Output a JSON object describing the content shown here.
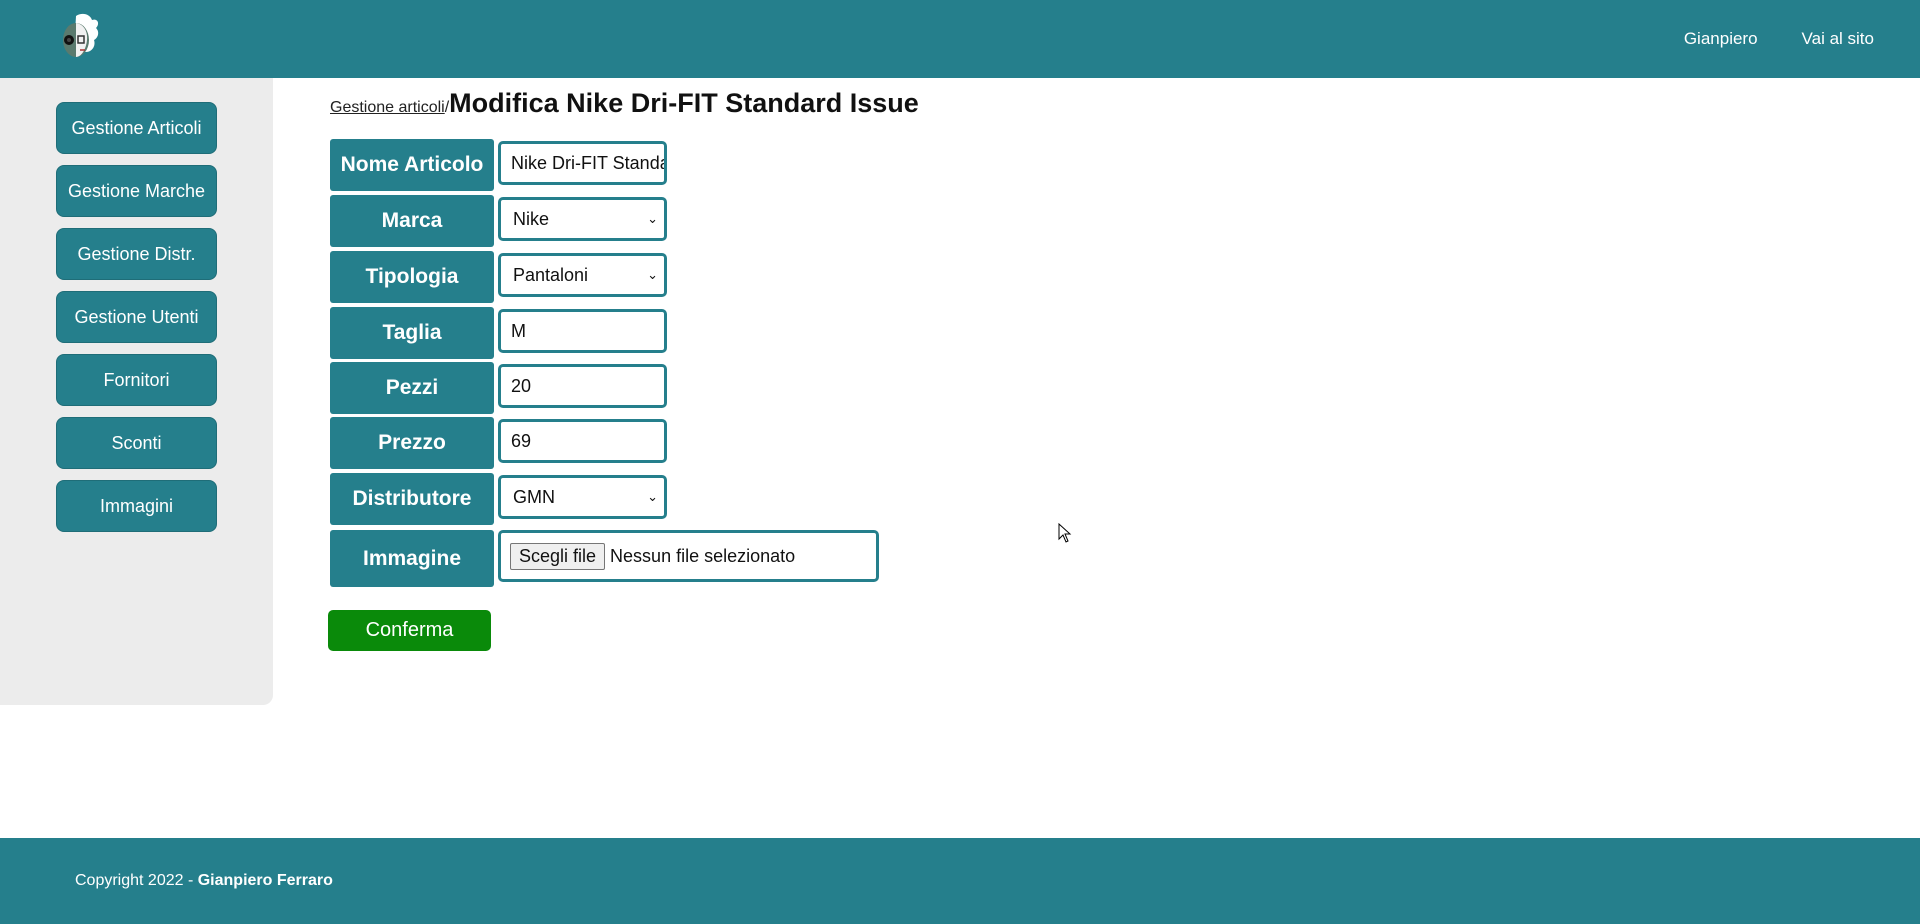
{
  "header": {
    "logo_icon": "avatar-logo-icon",
    "nav": [
      "Gianpiero",
      "Vai al sito"
    ]
  },
  "sidebar": {
    "items": [
      "Gestione Articoli",
      "Gestione Marche",
      "Gestione Distr.",
      "Gestione Utenti",
      "Fornitori",
      "Sconti",
      "Immagini"
    ]
  },
  "breadcrumb": {
    "link": "Gestione articoli",
    "separator": "/",
    "title": "Modifica Nike Dri-FIT Standard Issue"
  },
  "form": {
    "nome_articolo": {
      "label": "Nome Articolo",
      "value": "Nike Dri-FIT Standard Issue"
    },
    "marca": {
      "label": "Marca",
      "value": "Nike"
    },
    "tipologia": {
      "label": "Tipologia",
      "value": "Pantaloni"
    },
    "taglia": {
      "label": "Taglia",
      "value": "M"
    },
    "pezzi": {
      "label": "Pezzi",
      "value": "20"
    },
    "prezzo": {
      "label": "Prezzo",
      "value": "69"
    },
    "distributore": {
      "label": "Distributore",
      "value": "GMN"
    },
    "immagine": {
      "label": "Immagine",
      "button": "Scegli file",
      "status": "Nessun file selezionato"
    },
    "submit": "Conferma"
  },
  "footer": {
    "prefix": "Copyright 2022 - ",
    "author": "Gianpiero Ferraro"
  },
  "colors": {
    "primary": "#257f8c",
    "confirm": "#0a8a0a",
    "sidebar_bg": "#ececec"
  }
}
